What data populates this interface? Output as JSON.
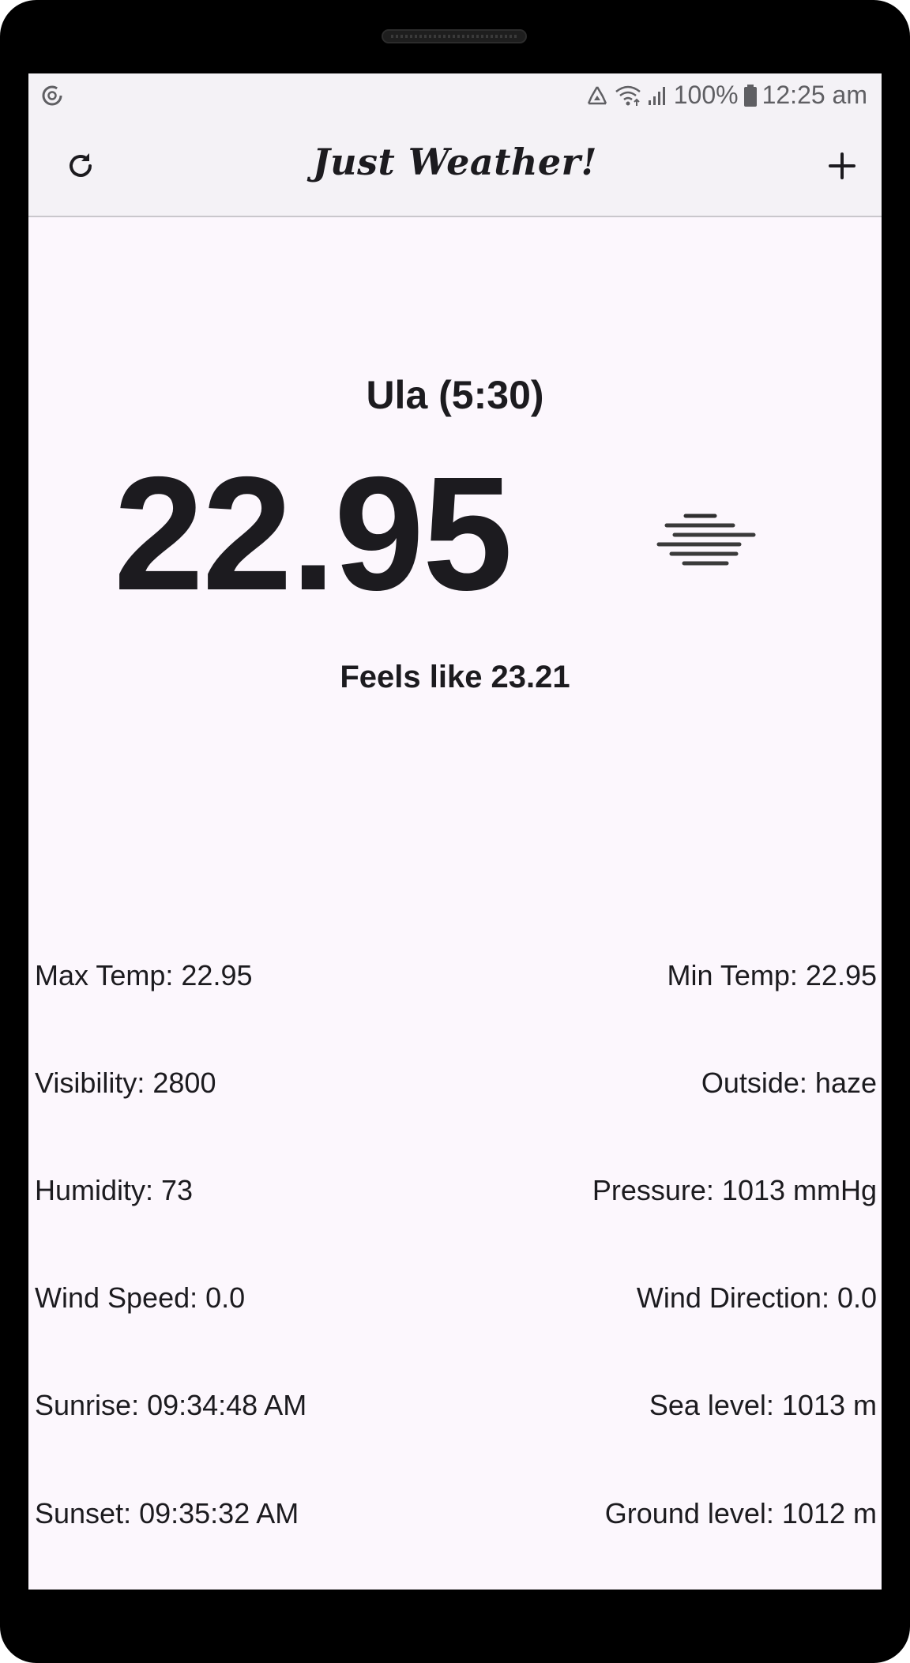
{
  "status_bar": {
    "battery": "100%",
    "time": "12:25 am",
    "icons": [
      "data-saver-icon",
      "recycle-icon",
      "wifi-icon",
      "signal-icon",
      "battery-icon"
    ]
  },
  "app_bar": {
    "title": "Just Weather!",
    "left_action_icon": "refresh-icon",
    "right_action_icon": "add-icon"
  },
  "weather": {
    "location": "Ula (5:30)",
    "temperature": "22.95",
    "condition_icon": "haze-icon",
    "feels_like": "Feels like 23.21"
  },
  "details": [
    {
      "left": "Max Temp: 22.95",
      "right": "Min Temp: 22.95"
    },
    {
      "left": "Visibility: 2800",
      "right": "Outside: haze"
    },
    {
      "left": "Humidity: 73",
      "right": "Pressure: 1013 mmHg"
    },
    {
      "left": "Wind Speed: 0.0",
      "right": "Wind Direction: 0.0"
    },
    {
      "left": "Sunrise: 09:34:48 AM",
      "right": "Sea level: 1013 m"
    },
    {
      "left": "Sunset: 09:35:32 AM",
      "right": "Ground level: 1012 m"
    }
  ],
  "colors": {
    "background": "#fcf7fd",
    "bar": "#f4f2f6",
    "text": "#1c1b1f",
    "status_text": "#5f5f63",
    "frame": "#000000"
  }
}
